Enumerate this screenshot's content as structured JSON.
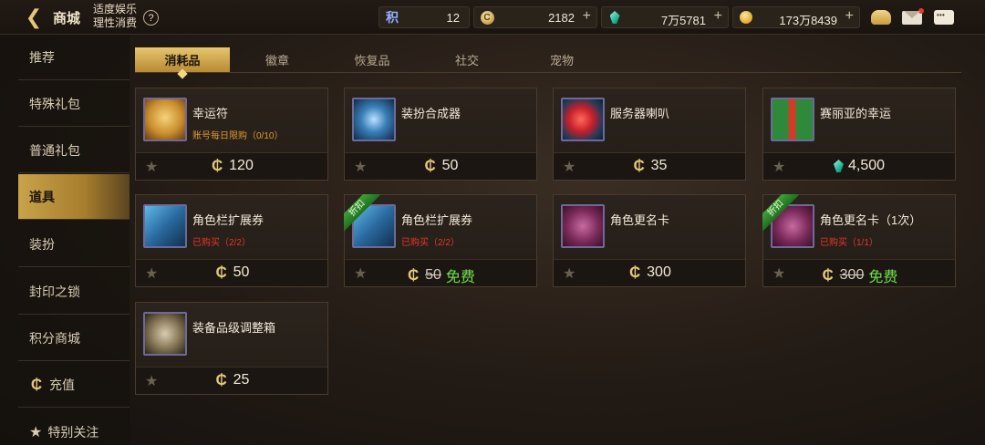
{
  "header": {
    "title": "商城",
    "notice_line1": "适度娱乐",
    "notice_line2": "理性消费",
    "help": "?"
  },
  "currencies": [
    {
      "icon": "points-icon",
      "symbol": "积",
      "value": "12"
    },
    {
      "icon": "c-coin-icon",
      "symbol": "C",
      "value": "2182"
    },
    {
      "icon": "gem-icon",
      "value": "7万5781"
    },
    {
      "icon": "gold-coin-icon",
      "value": "173万8439"
    }
  ],
  "sidebar": {
    "items": [
      {
        "label": "推荐"
      },
      {
        "label": "特殊礼包"
      },
      {
        "label": "普通礼包"
      },
      {
        "label": "道具",
        "active": true
      },
      {
        "label": "装扮"
      },
      {
        "label": "封印之锁"
      },
      {
        "label": "积分商城"
      },
      {
        "label": "充值"
      },
      {
        "label": "特别关注"
      }
    ]
  },
  "tabs": [
    {
      "label": "消耗品",
      "active": true
    },
    {
      "label": "徽章"
    },
    {
      "label": "恢复品"
    },
    {
      "label": "社交"
    },
    {
      "label": "宠物"
    }
  ],
  "items": [
    {
      "name": "幸运符",
      "sub": "账号每日限购（0/10）",
      "price": "120",
      "currency": "C"
    },
    {
      "name": "装扮合成器",
      "price": "50",
      "currency": "C"
    },
    {
      "name": "服务器喇叭",
      "price": "35",
      "currency": "C"
    },
    {
      "name": "赛丽亚的幸运",
      "price": "4,500",
      "currency": "gem"
    },
    {
      "name": "角色栏扩展券",
      "sub": "已购买（2/2）",
      "price": "50",
      "currency": "C"
    },
    {
      "name": "角色栏扩展券",
      "sub": "已购买（2/2）",
      "old_price": "50",
      "free": "免费",
      "ribbon": "折扣",
      "currency": "C"
    },
    {
      "name": "角色更名卡",
      "price": "300",
      "currency": "C"
    },
    {
      "name": "角色更名卡（1次）",
      "sub": "已购买（1/1）",
      "old_price": "300",
      "free": "免费",
      "ribbon": "折扣",
      "currency": "C"
    },
    {
      "name": "装备品级调整箱",
      "price": "25",
      "currency": "C"
    }
  ],
  "colors": {
    "accent_gold": "#c9a34a",
    "free_green": "#6fe24a",
    "limit_orange": "#e19a2e",
    "purchased_red": "#e8362b"
  }
}
